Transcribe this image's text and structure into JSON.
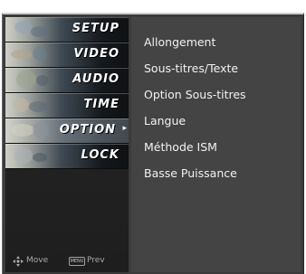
{
  "sidebar": {
    "items": [
      {
        "label": "SETUP",
        "icon": "setup-thumbnail-icon"
      },
      {
        "label": "VIDEO",
        "icon": "video-thumbnail-icon"
      },
      {
        "label": "AUDIO",
        "icon": "audio-thumbnail-icon"
      },
      {
        "label": "TIME",
        "icon": "time-thumbnail-icon"
      },
      {
        "label": "OPTION",
        "icon": "option-thumbnail-icon",
        "selected": true,
        "arrow": "▸"
      },
      {
        "label": "LOCK",
        "icon": "lock-thumbnail-icon"
      }
    ]
  },
  "footer": {
    "move_label": "Move",
    "prev_key_label": "MENU",
    "prev_label": "Prev"
  },
  "options": {
    "items": [
      "Allongement",
      "Sous-titres/Texte",
      "Option Sous-titres",
      "Langue",
      "Méthode ISM",
      "Basse Puissance"
    ]
  },
  "colors": {
    "panel_bg": "#444444",
    "menu_bg": "#262626",
    "text": "#f2f2f2"
  }
}
